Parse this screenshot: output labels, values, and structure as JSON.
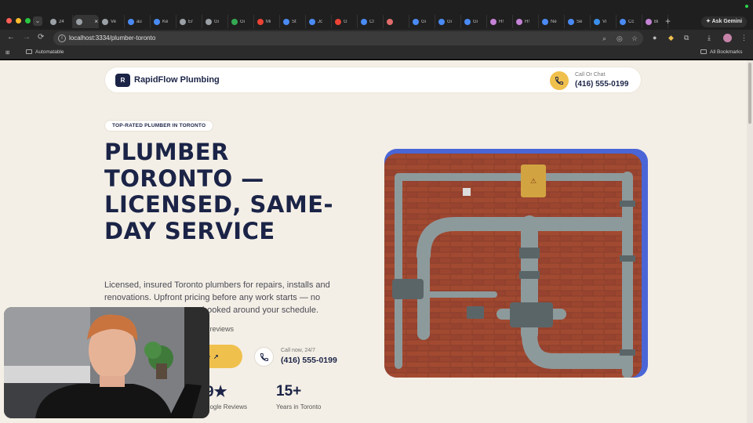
{
  "browser": {
    "active_tab_close": "×",
    "tabs": [
      {
        "label": "24",
        "color": "#9aa0a6"
      },
      {
        "label": "",
        "color": "#9aa0a6",
        "active": true
      },
      {
        "label": "Ve",
        "color": "#9aa0a6"
      },
      {
        "label": "au",
        "color": "#4a8af4"
      },
      {
        "label": "Ke",
        "color": "#4a8af4"
      },
      {
        "label": "Er",
        "color": "#9aa0a6"
      },
      {
        "label": "Gi",
        "color": "#9aa0a6"
      },
      {
        "label": "Gi",
        "color": "#34a853"
      },
      {
        "label": "Mi",
        "color": "#ea4335"
      },
      {
        "label": "St",
        "color": "#4a8af4"
      },
      {
        "label": "Jc",
        "color": "#4a8af4"
      },
      {
        "label": "G",
        "color": "#ea4335"
      },
      {
        "label": "Cl",
        "color": "#4a8af4"
      },
      {
        "label": "",
        "color": "#e06c6c"
      },
      {
        "label": "Gi",
        "color": "#4a8af4"
      },
      {
        "label": "Gi",
        "color": "#4a8af4"
      },
      {
        "label": "Gi",
        "color": "#4a8af4"
      },
      {
        "label": "H!",
        "color": "#c583d6"
      },
      {
        "label": "H!",
        "color": "#c583d6"
      },
      {
        "label": "Ne",
        "color": "#4a8af4"
      },
      {
        "label": "Se",
        "color": "#4a8af4"
      },
      {
        "label": "Vi",
        "color": "#3b8eea"
      },
      {
        "label": "Cc",
        "color": "#4a8af4"
      },
      {
        "label": "Bi",
        "color": "#c583d6"
      }
    ],
    "new_tab": "+",
    "ask_gemini": "Ask Gemini",
    "url": "localhost:3334/plumber-toronto",
    "bookmarks": {
      "left": "Automatable",
      "right": "All Bookmarks"
    },
    "icons": {
      "back": "←",
      "forward": "→",
      "reload": "⟳",
      "zoom": "⌕",
      "star": "☆",
      "download": "⤓",
      "menu": "⋮"
    }
  },
  "site": {
    "logo_letter": "R",
    "brand": "RapidFlow Plumbing",
    "header_call_label": "Call Or Chat",
    "header_phone": "(416) 555-0199",
    "badge": "TOP-RATED PLUMBER IN TORONTO",
    "hero_title": "PLUMBER TORONTO — LICENSED, SAME-DAY SERVICE",
    "hero_desc_lines": [
      "Licensed, insured Toronto plumbers for repairs, installs and",
      "renovations. Upfront pricing before any work starts — no",
      "booked around your schedule."
    ],
    "rating_text": "le reviews",
    "cta_label": "te",
    "cta_arrow": "↗",
    "call_now_label": "Call now, 24/7",
    "call_now_phone": "(416) 555-0199",
    "stats": [
      {
        "value": "9★",
        "label": "oogle Reviews"
      },
      {
        "value": "15+",
        "label": "Years in Toronto"
      }
    ]
  },
  "colors": {
    "navy": "#1b2447",
    "accent_yellow": "#f0c04d",
    "page_bg": "#f4efe6",
    "image_frame": "#4a66d6"
  }
}
